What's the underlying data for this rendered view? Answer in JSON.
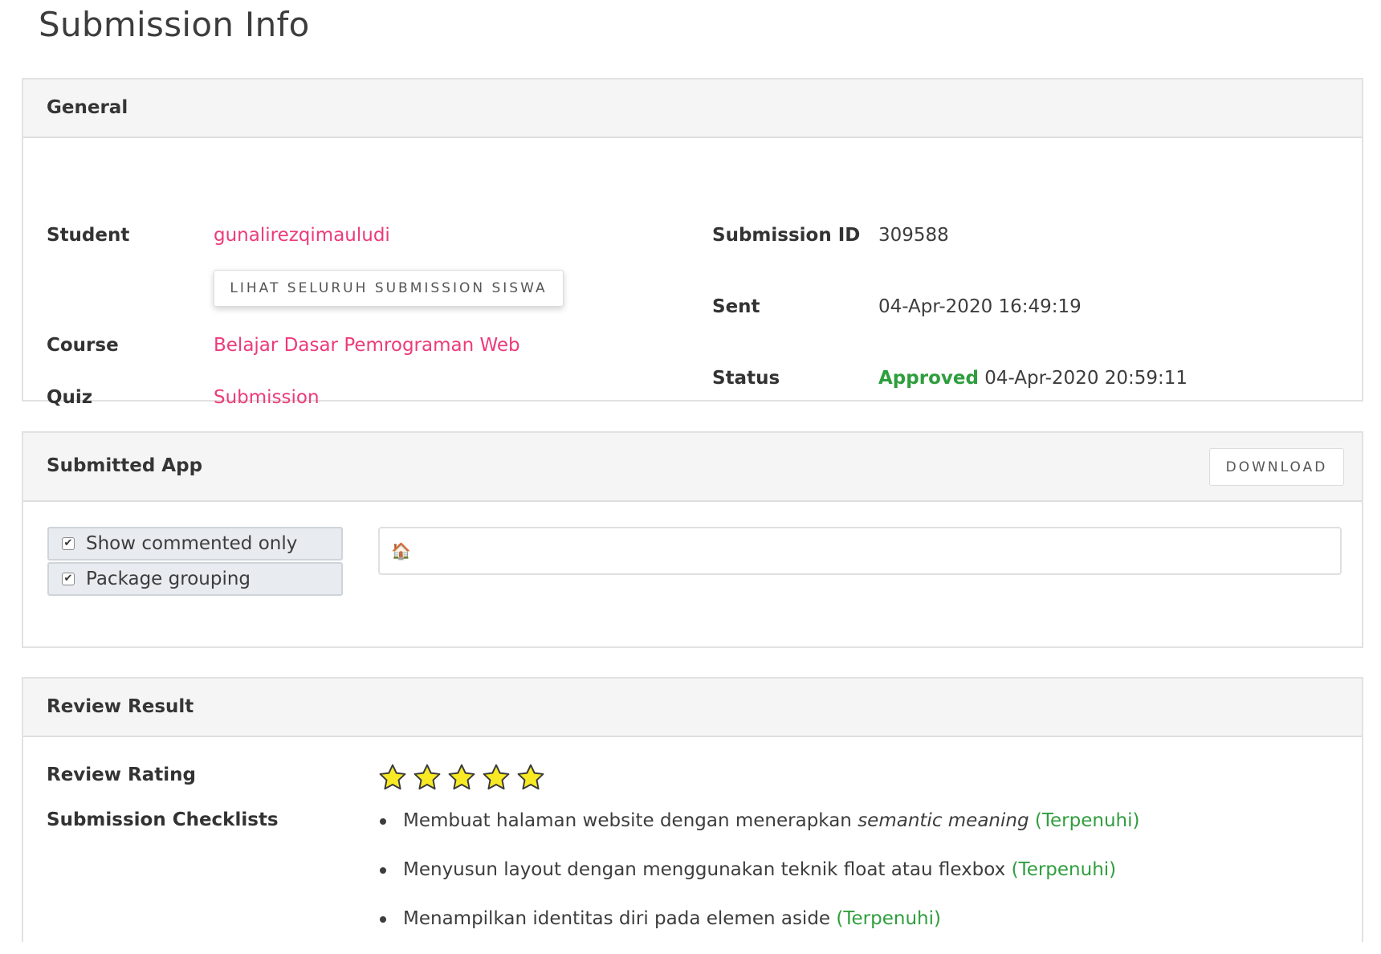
{
  "page_title": "Submission Info",
  "general": {
    "header": "General",
    "student_label": "Student",
    "student_value": "gunalirezqimauludi",
    "view_all_button": "LIHAT SELURUH SUBMISSION SISWA",
    "course_label": "Course",
    "course_value": "Belajar Dasar Pemrograman Web",
    "quiz_label": "Quiz",
    "quiz_value": "Submission",
    "submission_id_label": "Submission ID",
    "submission_id_value": "309588",
    "sent_label": "Sent",
    "sent_value": "04-Apr-2020 16:49:19",
    "status_label": "Status",
    "status_value": "Approved",
    "status_date": "04-Apr-2020 20:59:11",
    "status_color": "#2f9e3e",
    "link_color": "#ec3b7a"
  },
  "submitted_app": {
    "header": "Submitted App",
    "download_button": "DOWNLOAD",
    "toggles": [
      {
        "label": "Show commented only",
        "checked": true
      },
      {
        "label": "Package grouping",
        "checked": true
      }
    ],
    "file_tree_icon": "house-icon"
  },
  "review": {
    "header": "Review Result",
    "rating_label": "Review Rating",
    "rating": 5,
    "rating_max": 5,
    "checklist_label": "Submission Checklists",
    "checklist": [
      {
        "text_before": "Membuat halaman website dengan menerapkan ",
        "emphasis": "semantic meaning",
        "status": "(Terpenuhi)"
      },
      {
        "text_before": "Menyusun layout dengan menggunakan teknik float atau flexbox",
        "emphasis": "",
        "status": "(Terpenuhi)"
      },
      {
        "text_before": "Menampilkan identitas diri pada elemen aside",
        "emphasis": "",
        "status": "(Terpenuhi)"
      }
    ]
  }
}
